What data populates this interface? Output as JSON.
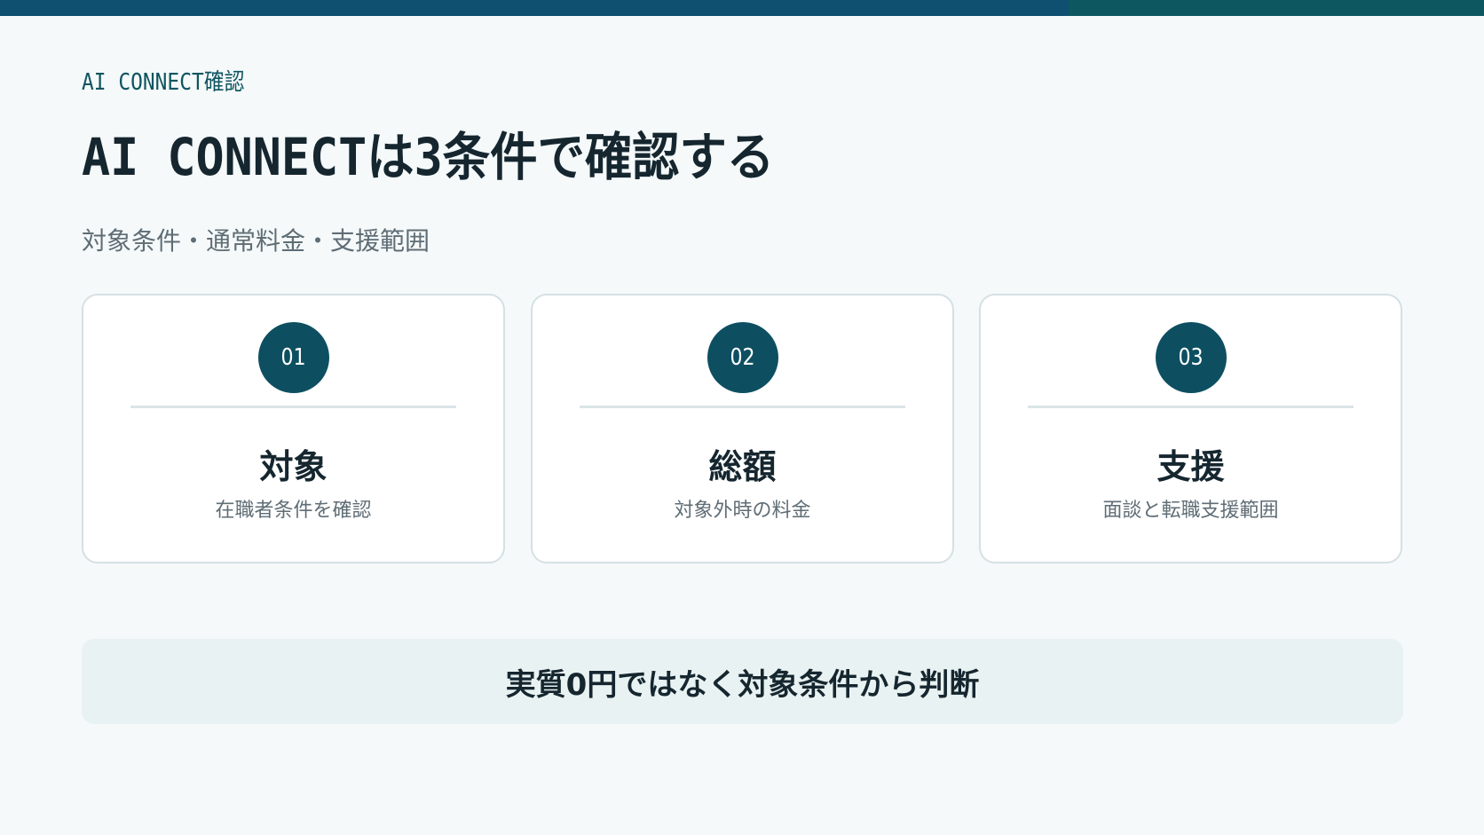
{
  "header": {
    "eyebrow": "AI CONNECT確認",
    "title": "AI CONNECTは3条件で確認する",
    "subtitle": "対象条件・通常料金・支援範囲"
  },
  "cards": [
    {
      "number": "01",
      "title": "対象",
      "description": "在職者条件を確認"
    },
    {
      "number": "02",
      "title": "総額",
      "description": "対象外時の料金"
    },
    {
      "number": "03",
      "title": "支援",
      "description": "面談と転職支援範囲"
    }
  ],
  "footer": {
    "text": "実質0円ではなく対象条件から判断"
  },
  "colors": {
    "top_bar": "#0f4f6f",
    "accent": "#0d4f61",
    "background": "#f5f9fa",
    "footer_bg": "#e9f2f2"
  }
}
